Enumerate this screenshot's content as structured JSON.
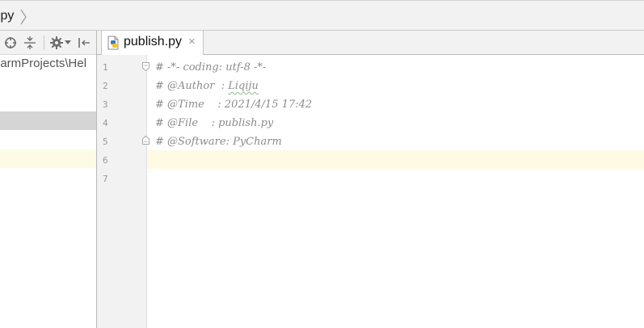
{
  "breadcrumb": {
    "file_label": ".py"
  },
  "left_panel": {
    "toolbar_icons": [
      "target-icon",
      "collapse-icon",
      "gear-icon",
      "chevron-down-icon",
      "hide-panel-icon"
    ],
    "project_path": "harmProjects\\Hel"
  },
  "tabs": [
    {
      "label": "publish.py",
      "icon": "python-file-icon",
      "close": "×"
    }
  ],
  "editor": {
    "lines": [
      {
        "number": "1",
        "text": "# -*- coding: utf-8 -*-"
      },
      {
        "number": "2",
        "text": "# @Author  : ",
        "highlight": "Liqiju"
      },
      {
        "number": "3",
        "text": "# @Time    : 2021/4/15 17:42"
      },
      {
        "number": "4",
        "text": "# @File    : publish.py"
      },
      {
        "number": "5",
        "text": "# @Software: PyCharm"
      },
      {
        "number": "6",
        "text": ""
      },
      {
        "number": "7",
        "text": ""
      }
    ],
    "current_line": "6"
  },
  "colors": {
    "comment": "#8c8c8c",
    "caret_row": "#fffae3",
    "gutter_bg": "#f2f2f2",
    "selection": "#d5d5d5"
  }
}
